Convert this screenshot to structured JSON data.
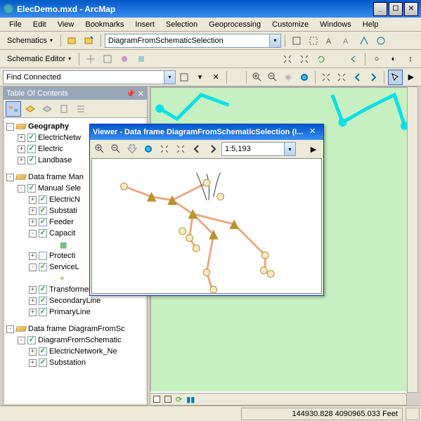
{
  "title": "ElecDemo.mxd - ArcMap",
  "menu": [
    "File",
    "Edit",
    "View",
    "Bookmarks",
    "Insert",
    "Selection",
    "Geoprocessing",
    "Customize",
    "Windows",
    "Help"
  ],
  "schematics_label": "Schematics",
  "diagram_combo": "DiagramFromSchematicSelection",
  "schematic_editor_label": "Schematic Editor",
  "find_connected": "Find Connected",
  "toc": {
    "title": "Table Of Contents",
    "items": [
      {
        "level": 0,
        "exp": "-",
        "label": "Geography",
        "bold": true,
        "icon": "layer"
      },
      {
        "level": 1,
        "exp": "+",
        "chk": true,
        "label": "ElectricNetw"
      },
      {
        "level": 1,
        "exp": "+",
        "chk": true,
        "label": "Electric"
      },
      {
        "level": 1,
        "exp": "+",
        "chk": true,
        "label": "Landbase"
      },
      {
        "level": -1,
        "label": ""
      },
      {
        "level": 0,
        "exp": "-",
        "label": "Data frame Man",
        "icon": "layer"
      },
      {
        "level": 1,
        "exp": "-",
        "chk": true,
        "label": "Manual Sele"
      },
      {
        "level": 2,
        "exp": "+",
        "chk": true,
        "label": "ElectricN"
      },
      {
        "level": 2,
        "exp": "+",
        "chk": true,
        "label": "Substati"
      },
      {
        "level": 2,
        "exp": "+",
        "chk": true,
        "label": "Feeder"
      },
      {
        "level": 2,
        "exp": "-",
        "chk": true,
        "label": "Capacit"
      },
      {
        "level": 3,
        "label": "",
        "sym": "grid"
      },
      {
        "level": 2,
        "exp": "+",
        "chk": false,
        "label": "Protecti"
      },
      {
        "level": 2,
        "exp": "-",
        "chk": true,
        "label": "ServiceL"
      },
      {
        "level": 3,
        "label": "",
        "sym": "circle"
      },
      {
        "level": 2,
        "exp": "+",
        "chk": true,
        "label": "TransformerBank"
      },
      {
        "level": 2,
        "exp": "+",
        "chk": true,
        "label": "SecondaryLine"
      },
      {
        "level": 2,
        "exp": "+",
        "chk": true,
        "label": "PrimaryLine"
      },
      {
        "level": -1,
        "label": ""
      },
      {
        "level": 0,
        "exp": "-",
        "label": "Data frame DiagramFromSc",
        "icon": "layer"
      },
      {
        "level": 1,
        "exp": "-",
        "chk": true,
        "label": "DiagramFromSchematic"
      },
      {
        "level": 2,
        "exp": "+",
        "chk": true,
        "label": "ElectricNetwork_Ne"
      },
      {
        "level": 2,
        "exp": "+",
        "chk": true,
        "label": "Substation"
      }
    ]
  },
  "viewer": {
    "title": "Viewer - Data frame DiagramFromSchematicSelection (I...",
    "scale": "1:5,193"
  },
  "status": {
    "coords": "144930.828 4090965.033 Feet"
  }
}
